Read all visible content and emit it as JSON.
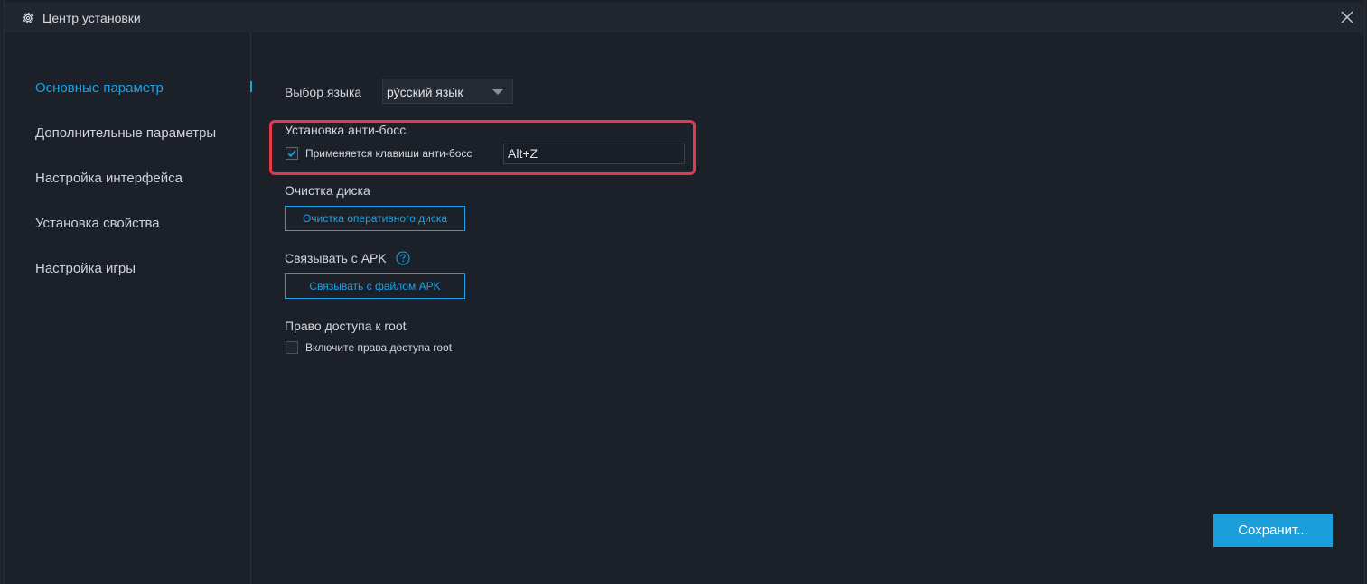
{
  "window": {
    "title": "Центр установки",
    "icons": {
      "title": "gear-icon",
      "close": "close-icon"
    }
  },
  "sidebar": {
    "items": [
      {
        "label": "Основные параметр",
        "active": true
      },
      {
        "label": "Дополнительные параметры",
        "active": false
      },
      {
        "label": "Настройка интерфейса",
        "active": false
      },
      {
        "label": "Установка свойства",
        "active": false
      },
      {
        "label": "Настройка игры",
        "active": false
      }
    ]
  },
  "language": {
    "label": "Выбор языка",
    "selected": "ру́сский язы́к"
  },
  "antiboss": {
    "section_title": "Установка анти-босс",
    "checkbox_label": "Применяется клавиши анти-босс",
    "checked": true,
    "hotkey_value": "Alt+Z"
  },
  "disk": {
    "section_title": "Очистка диска",
    "button_label": "Очистка оперативного диска"
  },
  "apk": {
    "section_title": "Связывать с APK",
    "button_label": "Связывать с файлом APK",
    "help_icon": "help-icon"
  },
  "root": {
    "section_title": "Право доступа к root",
    "checkbox_label": "Включите права доступа root",
    "checked": false
  },
  "footer": {
    "save_label": "Сохранит..."
  },
  "colors": {
    "accent": "#1aa3e5",
    "highlight": "#e23a4b",
    "background": "#1b2029",
    "titlebar": "#22262e"
  }
}
